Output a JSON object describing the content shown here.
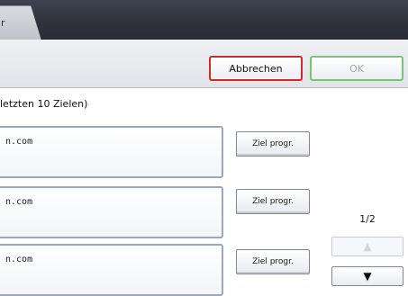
{
  "topbar": {
    "tab_label": "r"
  },
  "buttons": {
    "cancel": "Abbrechen",
    "ok": "OK"
  },
  "history": {
    "header": "letzten 10 Zielen)",
    "entries": [
      {
        "text": "n.com",
        "button": "Ziel progr."
      },
      {
        "text": "n.com",
        "button": "Ziel progr."
      },
      {
        "text": "n.com",
        "button": "Ziel progr."
      }
    ]
  },
  "pagination": {
    "label": "1/2",
    "up": "▲",
    "down": "▼"
  }
}
